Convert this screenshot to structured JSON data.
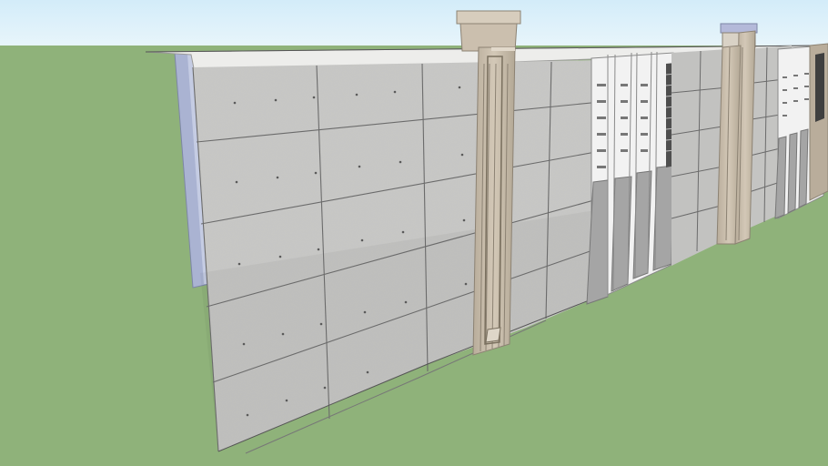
{
  "scene": {
    "sky_color": "#dff0fa",
    "ground_color": "#8fb27a",
    "concrete_color": "#c7c7c5",
    "joint_color": "#6b6b6b",
    "pillar_color": "#cbbfae",
    "pillar_edge_color": "#8c8273",
    "cap_color": "#ececec",
    "side_panel_color": "#aab3d2",
    "chimney_cap_color": "#b4b9d9"
  }
}
